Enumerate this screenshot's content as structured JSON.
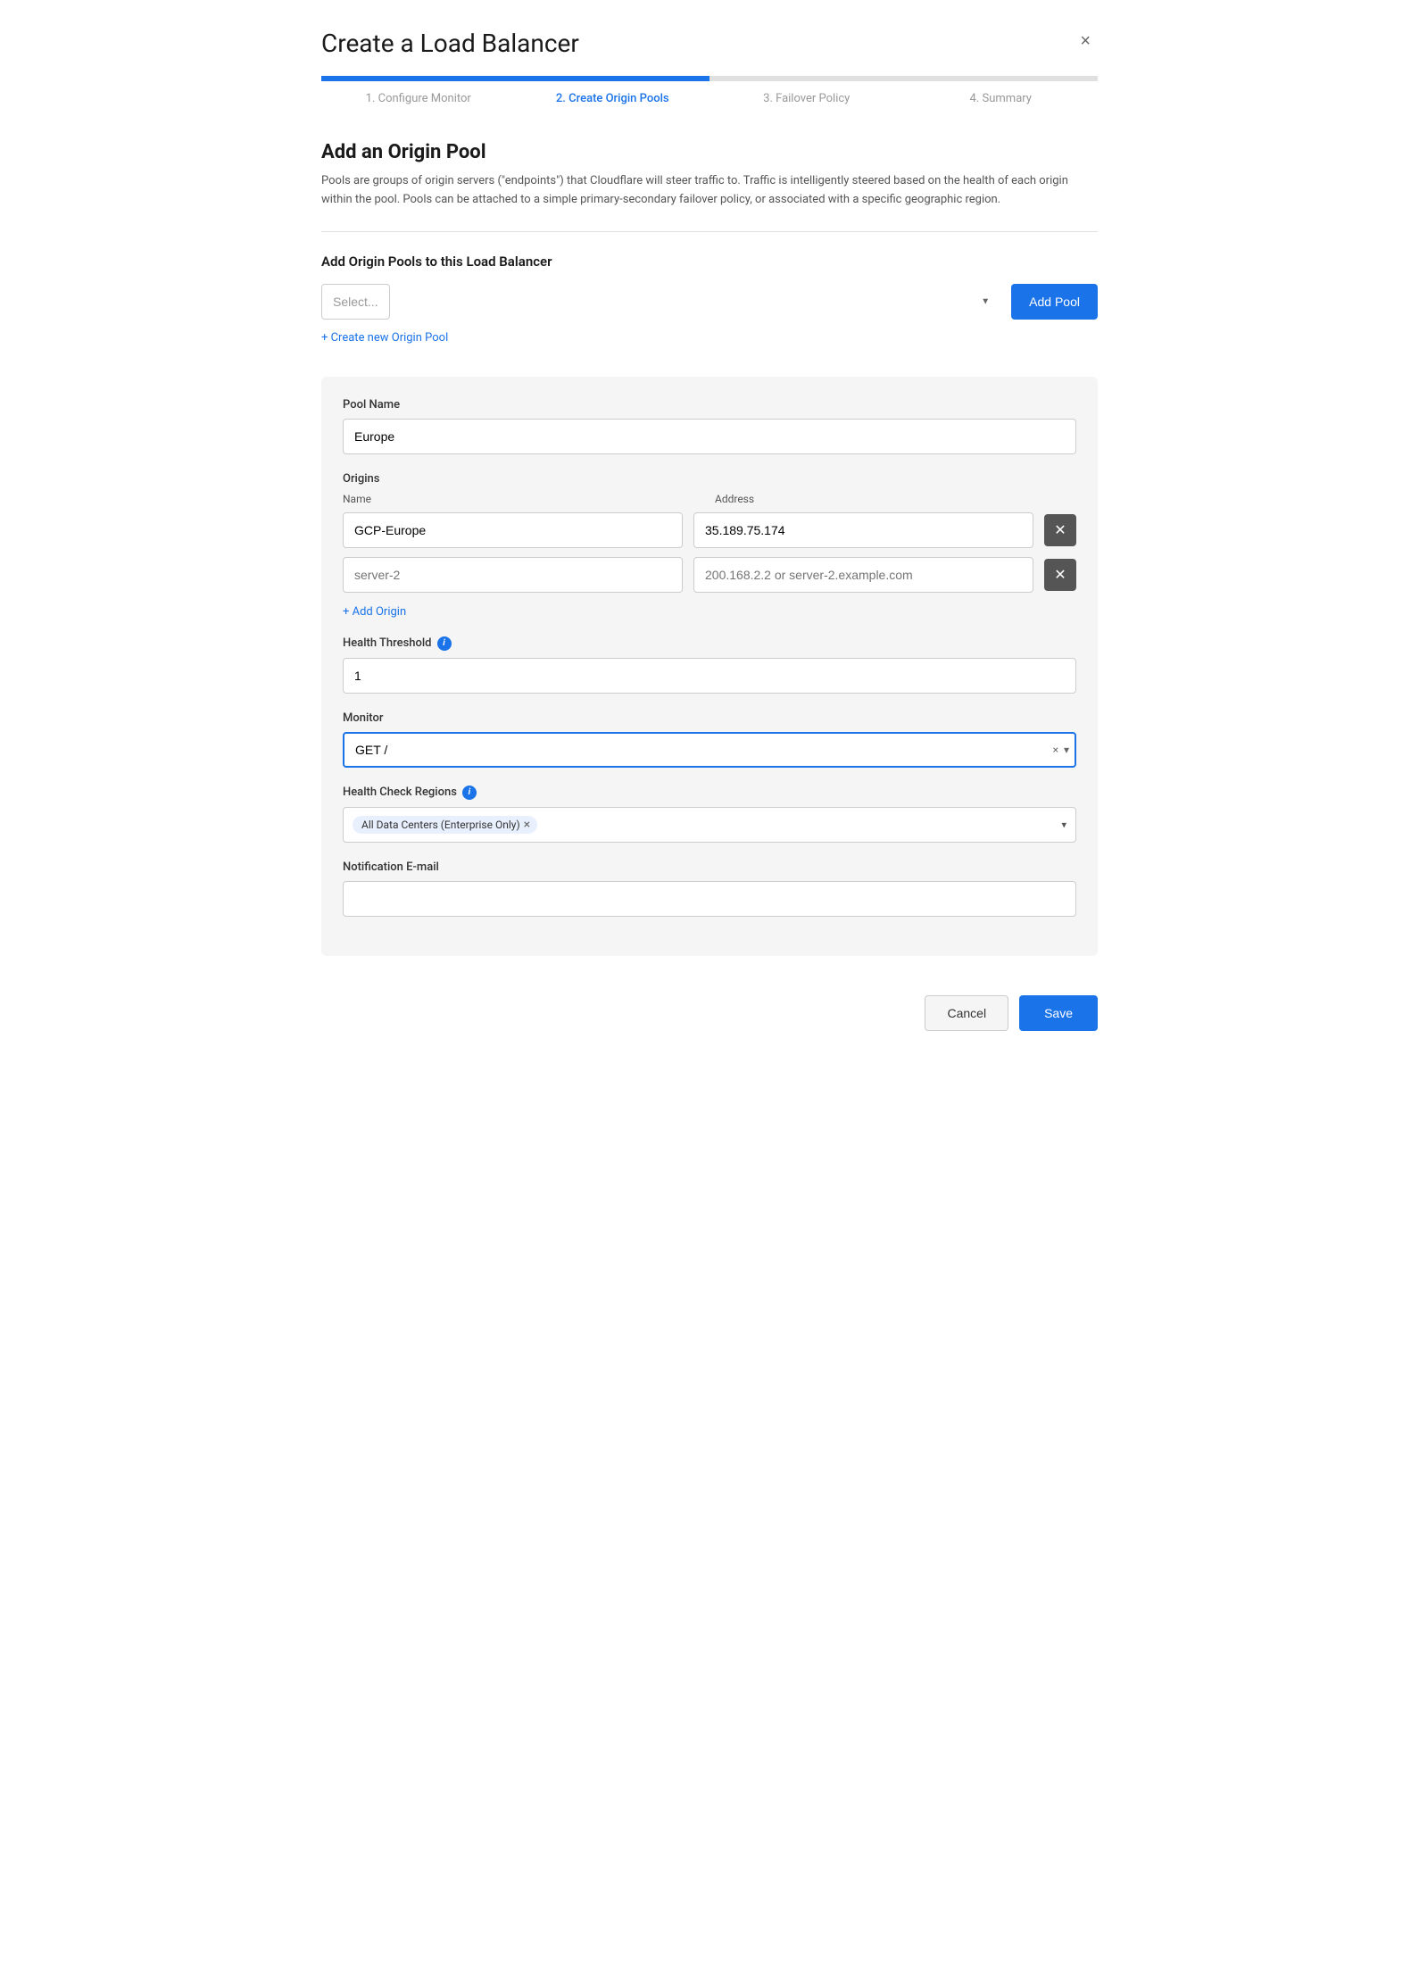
{
  "modal": {
    "title": "Create a Load Balancer",
    "close_label": "×"
  },
  "steps": [
    {
      "label": "1. Configure Monitor",
      "active": false
    },
    {
      "label": "2. Create Origin Pools",
      "active": true
    },
    {
      "label": "3. Failover Policy",
      "active": false
    },
    {
      "label": "4. Summary",
      "active": false
    }
  ],
  "section": {
    "title": "Add an Origin Pool",
    "description": "Pools are groups of origin servers (\"endpoints\") that Cloudflare will steer traffic to. Traffic is intelligently steered based on the health of each origin within the pool. Pools can be attached to a simple primary-secondary failover policy, or associated with a specific geographic region."
  },
  "add_pools": {
    "subsection_title": "Add Origin Pools to this Load Balancer",
    "select_placeholder": "Select...",
    "add_pool_button": "Add Pool",
    "create_new_link": "+ Create new Origin Pool"
  },
  "pool_form": {
    "pool_name_label": "Pool Name",
    "pool_name_value": "Europe",
    "origins_label": "Origins",
    "name_col_label": "Name",
    "address_col_label": "Address",
    "origins": [
      {
        "name": "GCP-Europe",
        "address": "35.189.75.174"
      },
      {
        "name": "",
        "address": ""
      }
    ],
    "name_placeholder": "server-2",
    "address_placeholder": "200.168.2.2 or server-2.example.com",
    "add_origin_link": "+ Add Origin",
    "health_threshold_label": "Health Threshold",
    "health_threshold_value": "1",
    "monitor_label": "Monitor",
    "monitor_value": "GET /",
    "monitor_clear": "×",
    "monitor_dropdown": "▾",
    "health_check_regions_label": "Health Check Regions",
    "health_check_tag": "All Data Centers (Enterprise Only)",
    "notification_email_label": "Notification E-mail",
    "notification_email_value": ""
  },
  "footer": {
    "cancel_label": "Cancel",
    "save_label": "Save"
  }
}
